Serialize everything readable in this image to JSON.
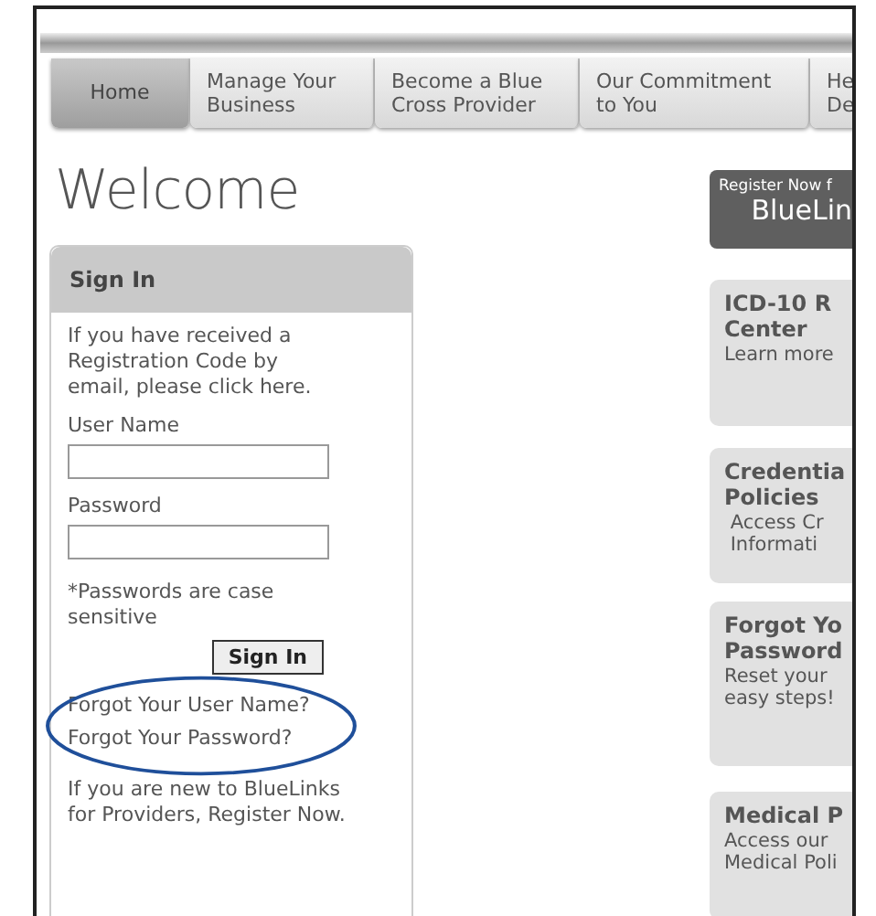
{
  "tabs": [
    {
      "label": "Home",
      "selected": true
    },
    {
      "label": "Manage Your\nBusiness",
      "selected": false
    },
    {
      "label": "Become a Blue\nCross Provider",
      "selected": false
    },
    {
      "label": "Our Commitment\nto You",
      "selected": false
    },
    {
      "label": "He\nDe",
      "selected": false
    }
  ],
  "heading": "Welcome",
  "sign_in": {
    "title": "Sign In",
    "intro": "If you have received a Registration Code by email, please click here.",
    "fields": [
      {
        "label": "User Name"
      },
      {
        "label": "Password"
      }
    ],
    "note": "*Passwords are case sensitive",
    "button": "Sign In",
    "forgot_links": {
      "circled": true,
      "items": [
        "Forgot Your User Name?",
        "Forgot Your Password?"
      ]
    },
    "register_text": "If you are new to BlueLinks for Providers, Register Now."
  },
  "banner": {
    "line_1": "Register Now f",
    "line_2": "BlueLin"
  },
  "cards": [
    {
      "title": "ICD-10 R\nCenter",
      "text": "Learn more"
    },
    {
      "title": "Credentia\nPolicies",
      "text": " Access Cr\n Informati"
    },
    {
      "title": "Forgot Yo\nPassword",
      "text": "Reset your\neasy steps!"
    },
    {
      "title": "Medical P",
      "text": "Access our\nMedical Poli"
    }
  ]
}
